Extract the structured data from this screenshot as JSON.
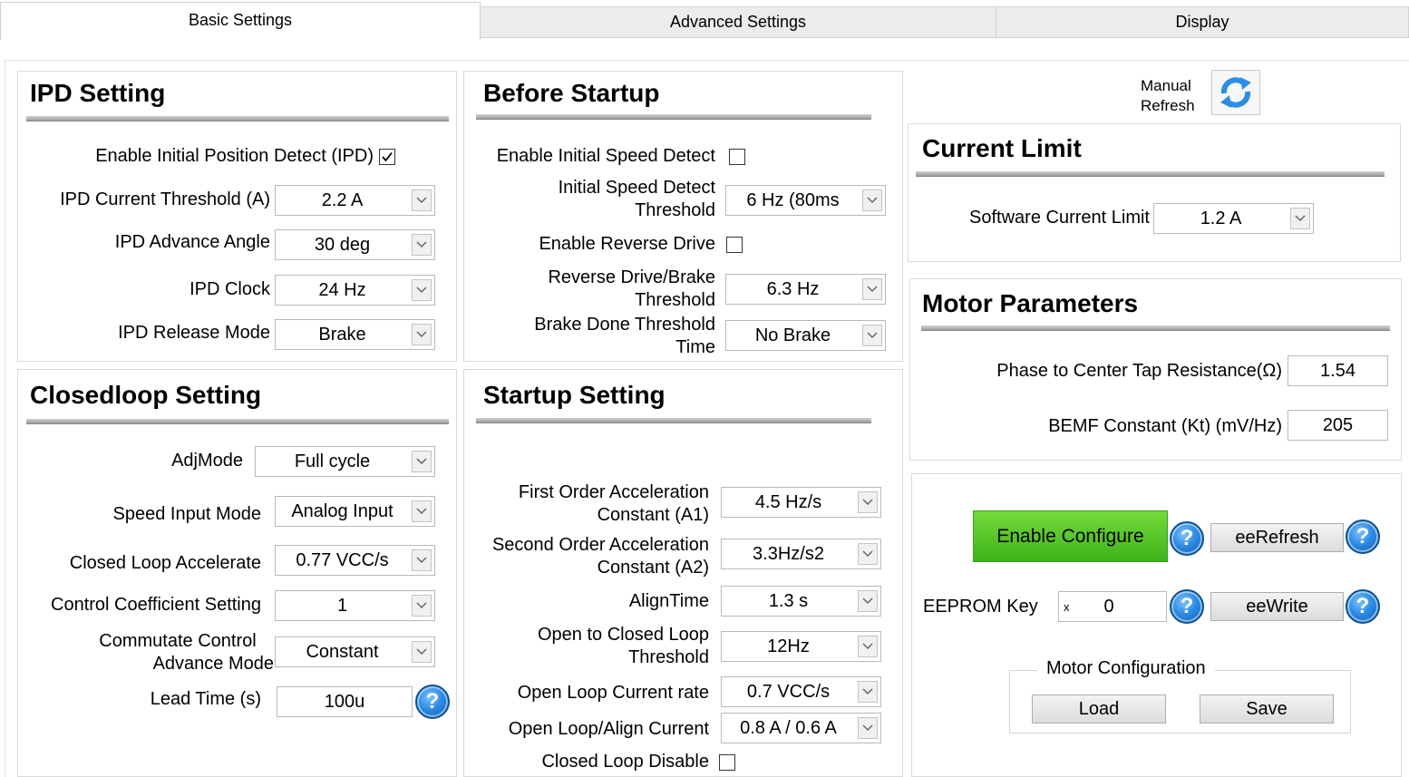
{
  "tabs": [
    "Basic Settings",
    "Advanced Settings",
    "Display"
  ],
  "manual_refresh": {
    "line1": "Manual",
    "line2": "Refresh",
    "icon": "refresh-icon"
  },
  "ipd": {
    "title": "IPD Setting",
    "enable_label": "Enable Initial Position Detect (IPD)",
    "enable_checked": true,
    "current_threshold_label": "IPD Current Threshold (A)",
    "current_threshold_value": "2.2 A",
    "advance_angle_label": "IPD Advance Angle",
    "advance_angle_value": "30 deg",
    "clock_label": "IPD Clock",
    "clock_value": "24 Hz",
    "release_mode_label": "IPD Release Mode",
    "release_mode_value": "Brake"
  },
  "closedloop": {
    "title": "Closedloop Setting",
    "adjmode_label": "AdjMode",
    "adjmode_value": "Full cycle",
    "speed_input_label": "Speed Input Mode",
    "speed_input_value": "Analog Input",
    "accel_label": "Closed Loop Accelerate",
    "accel_value": "0.77 VCC/s",
    "coeff_label": "Control Coefficient Setting",
    "coeff_value": "1",
    "commutate_label_1": "Commutate Control",
    "commutate_label_2": "Advance Mode",
    "commutate_value": "Constant",
    "lead_time_label": "Lead Time (s)",
    "lead_time_value": "100u"
  },
  "before_startup": {
    "title": "Before Startup",
    "isd_label": "Enable Initial Speed Detect",
    "isd_checked": false,
    "isd_threshold_label_1": "Initial Speed Detect",
    "isd_threshold_label_2": "Threshold",
    "isd_threshold_value": "6 Hz (80ms",
    "reverse_label": "Enable Reverse Drive",
    "reverse_checked": false,
    "reverse_threshold_label_1": "Reverse Drive/Brake",
    "reverse_threshold_label_2": "Threshold",
    "reverse_threshold_value": "6.3 Hz",
    "brake_done_label_1": "Brake Done Threshold",
    "brake_done_label_2": "Time",
    "brake_done_value": "No Brake"
  },
  "startup": {
    "title": "Startup Setting",
    "a1_label_1": "First Order Acceleration",
    "a1_label_2": "Constant (A1)",
    "a1_value": "4.5 Hz/s",
    "a2_label_1": "Second Order Acceleration",
    "a2_label_2": "Constant (A2)",
    "a2_value": "3.3Hz/s2",
    "align_time_label": "AlignTime",
    "align_time_value": "1.3 s",
    "otc_label_1": "Open to Closed Loop",
    "otc_label_2": "Threshold",
    "otc_value": "12Hz",
    "ol_current_rate_label": "Open Loop Current rate",
    "ol_current_rate_value": "0.7 VCC/s",
    "ol_align_current_label": "Open Loop/Align Current",
    "ol_align_current_value": "0.8 A / 0.6 A",
    "cl_disable_label": "Closed Loop Disable",
    "cl_disable_checked": false
  },
  "current_limit": {
    "title": "Current Limit",
    "sw_limit_label": "Software Current Limit",
    "sw_limit_value": "1.2 A"
  },
  "motor_params": {
    "title": "Motor Parameters",
    "resistance_label": "Phase to Center Tap Resistance(Ω)",
    "resistance_value": "1.54",
    "bemf_label": "BEMF Constant (Kt) (mV/Hz)",
    "bemf_value": "205"
  },
  "eeprom": {
    "enable_configure_label": "Enable Configure",
    "eerefresh_label": "eeRefresh",
    "key_label": "EEPROM Key",
    "key_prefix": "x",
    "key_value": "0",
    "eewrite_label": "eeWrite",
    "help_glyph": "?",
    "motor_config_label": "Motor Configuration",
    "load_label": "Load",
    "save_label": "Save"
  },
  "colors": {
    "accent_green": "#4cc222",
    "help_blue": "#1f7fd8"
  }
}
